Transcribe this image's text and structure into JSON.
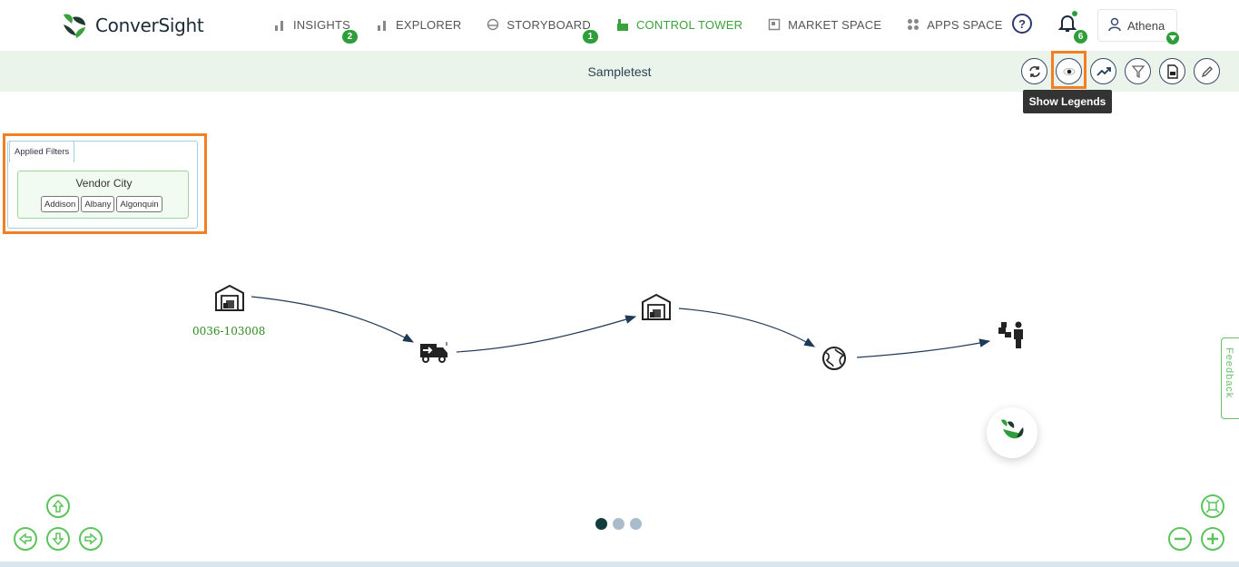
{
  "app": {
    "brand": "ConverSight",
    "colors": {
      "accent": "#2e9e3a",
      "highlight": "#f37f22",
      "subbar": "#eaf4ea",
      "navy": "#1e3a56"
    }
  },
  "nav": {
    "items": [
      {
        "label": "INSIGHTS",
        "icon": "bar-chart-icon",
        "badge": "2"
      },
      {
        "label": "EXPLORER",
        "icon": "bar-chart-icon",
        "badge": ""
      },
      {
        "label": "STORYBOARD",
        "icon": "storyboard-icon",
        "badge": "1"
      },
      {
        "label": "CONTROL TOWER",
        "icon": "control-tower-icon",
        "badge": "",
        "active": true
      },
      {
        "label": "MARKET SPACE",
        "icon": "market-space-icon",
        "badge": ""
      },
      {
        "label": "APPS SPACE",
        "icon": "apps-grid-icon",
        "badge": ""
      }
    ],
    "help_icon": "help-icon",
    "notifications": {
      "icon": "bell-icon",
      "count": "6"
    },
    "user": {
      "name": "Athena",
      "icon": "user-icon"
    }
  },
  "subheader": {
    "title": "Sampletest",
    "tools": [
      {
        "name": "refresh-icon"
      },
      {
        "name": "show-legends-icon",
        "highlighted": true
      },
      {
        "name": "trend-icon"
      },
      {
        "name": "filter-icon"
      },
      {
        "name": "pdf-icon"
      },
      {
        "name": "edit-icon"
      }
    ],
    "tooltip": "Show Legends"
  },
  "filters": {
    "tab_label": "Applied Filters",
    "filter_name": "Vendor City",
    "values": [
      "Addison",
      "Albany",
      "Algonquin"
    ]
  },
  "flow": {
    "nodes": [
      {
        "name": "warehouse-icon",
        "label": "0036-103008"
      },
      {
        "name": "delivery-truck-icon",
        "label": ""
      },
      {
        "name": "warehouse-icon",
        "label": ""
      },
      {
        "name": "globe-icon",
        "label": ""
      },
      {
        "name": "customer-icon",
        "label": ""
      }
    ]
  },
  "feedback": {
    "label": "Feedback"
  },
  "pager": {
    "pages": 3,
    "active": 1
  },
  "controls": {
    "pan": [
      "arrow-up-icon",
      "arrow-left-icon",
      "arrow-down-icon",
      "arrow-right-icon"
    ],
    "zoom": [
      "fit-screen-icon",
      "zoom-out-icon",
      "zoom-in-icon"
    ]
  }
}
